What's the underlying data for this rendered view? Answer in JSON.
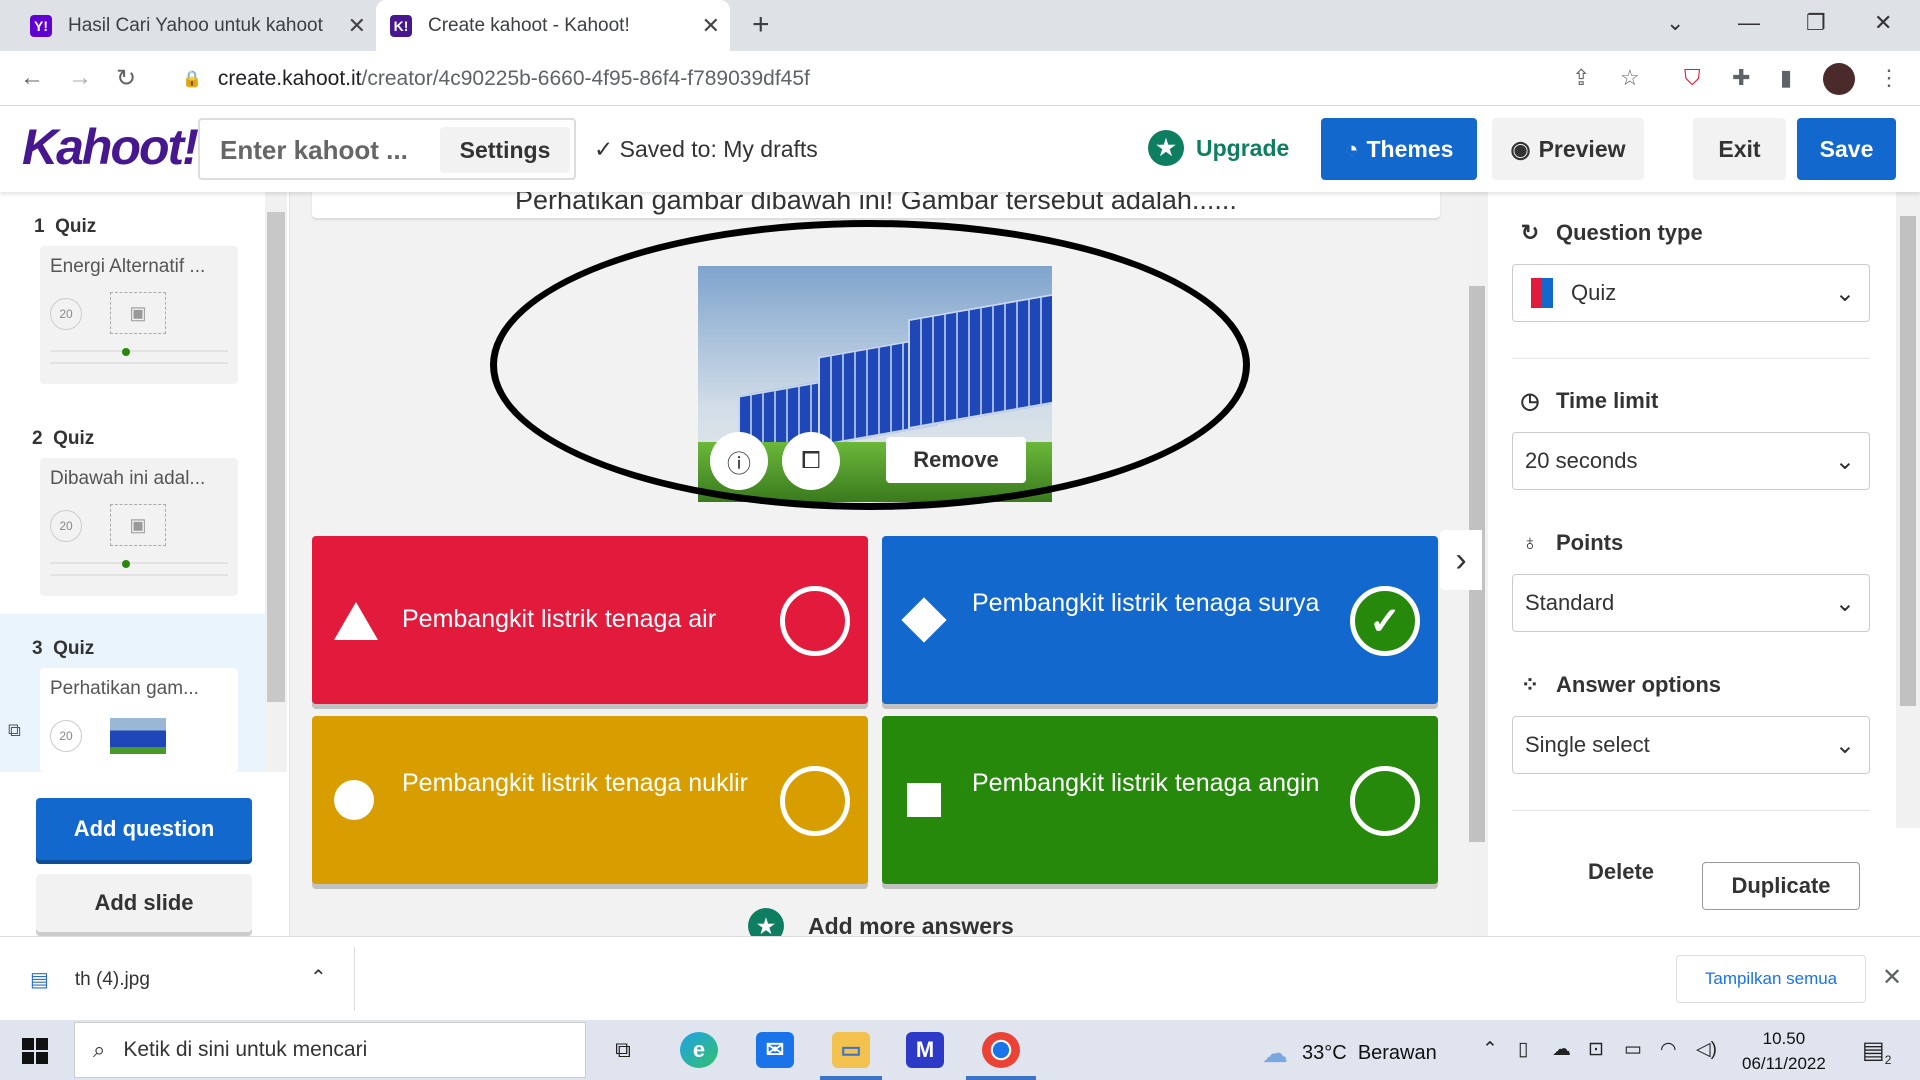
{
  "browser": {
    "tabs": [
      {
        "title": "Hasil Cari Yahoo untuk kahoot",
        "icon": "yahoo-icon",
        "favicon_text": "Y!",
        "favicon_color": "#6001d2"
      },
      {
        "title": "Create kahoot - Kahoot!",
        "icon": "kahoot-icon",
        "favicon_text": "K!",
        "favicon_color": "#46178f"
      }
    ],
    "url_host": "create.kahoot.it",
    "url_path": "/creator/4c90225b-6660-4f95-86f4-f789039df45f"
  },
  "header": {
    "logo": "Kahoot!",
    "title_placeholder": "Enter kahoot ...",
    "settings_label": "Settings",
    "saved_status": "Saved to: My drafts",
    "upgrade_label": "Upgrade",
    "themes_label": "Themes",
    "preview_label": "Preview",
    "exit_label": "Exit",
    "save_label": "Save",
    "colors": {
      "brand": "#46178f",
      "primary": "#1368ce",
      "upgrade": "#0e7e60"
    }
  },
  "sidebar": {
    "questions": [
      {
        "number": "1",
        "type": "Quiz",
        "title": "Energi Alternatif ...",
        "time": "20"
      },
      {
        "number": "2",
        "type": "Quiz",
        "title": "Dibawah ini adal...",
        "time": "20"
      },
      {
        "number": "3",
        "type": "Quiz",
        "title": "Perhatikan gam...",
        "time": "20"
      }
    ],
    "add_question_label": "Add question",
    "add_slide_label": "Add slide"
  },
  "editor": {
    "question_text": "Perhatikan gambar dibawah ini! Gambar tersebut adalah......",
    "remove_label": "Remove",
    "answers": [
      {
        "text": "Pembangkit listrik tenaga air",
        "shape": "triangle",
        "color": "#e21b3c",
        "correct": false
      },
      {
        "text": "Pembangkit listrik tenaga surya",
        "shape": "diamond",
        "color": "#1368ce",
        "correct": true
      },
      {
        "text": "Pembangkit listrik tenaga nuklir",
        "shape": "circle",
        "color": "#d89e00",
        "correct": false
      },
      {
        "text": "Pembangkit listrik tenaga angin",
        "shape": "square",
        "color": "#26890c",
        "correct": false
      }
    ],
    "add_more_answers_label": "Add more answers"
  },
  "settings_panel": {
    "question_type_label": "Question type",
    "question_type_value": "Quiz",
    "time_limit_label": "Time limit",
    "time_limit_value": "20 seconds",
    "points_label": "Points",
    "points_value": "Standard",
    "answer_options_label": "Answer options",
    "answer_options_value": "Single select",
    "delete_label": "Delete",
    "duplicate_label": "Duplicate"
  },
  "download_bar": {
    "file_name": "th (4).jpg",
    "show_all_label": "Tampilkan semua"
  },
  "taskbar": {
    "search_placeholder": "Ketik di sini untuk mencari",
    "temperature": "33°C",
    "weather": "Berawan",
    "time": "10.50",
    "date": "06/11/2022",
    "notification_count": "2"
  }
}
